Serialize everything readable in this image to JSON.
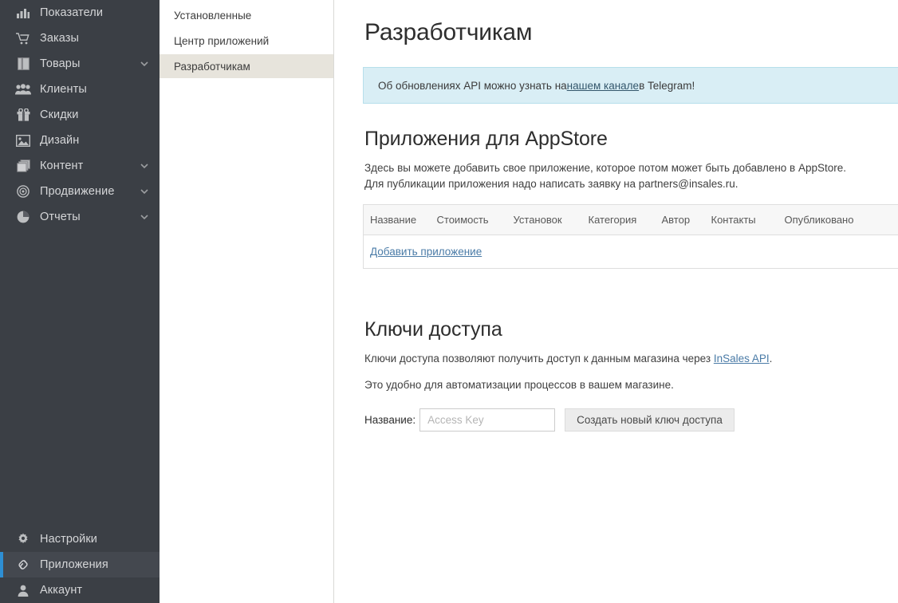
{
  "sidebar": {
    "items": [
      {
        "label": "Показатели",
        "icon": "bar-chart-icon",
        "chevron": false,
        "active": false
      },
      {
        "label": "Заказы",
        "icon": "cart-icon",
        "chevron": false,
        "active": false
      },
      {
        "label": "Товары",
        "icon": "box-icon",
        "chevron": true,
        "active": false
      },
      {
        "label": "Клиенты",
        "icon": "users-icon",
        "chevron": false,
        "active": false
      },
      {
        "label": "Скидки",
        "icon": "gift-icon",
        "chevron": false,
        "active": false
      },
      {
        "label": "Дизайн",
        "icon": "image-icon",
        "chevron": false,
        "active": false
      },
      {
        "label": "Контент",
        "icon": "layers-icon",
        "chevron": true,
        "active": false
      },
      {
        "label": "Продвижение",
        "icon": "target-icon",
        "chevron": true,
        "active": false
      },
      {
        "label": "Отчеты",
        "icon": "pie-chart-icon",
        "chevron": true,
        "active": false
      }
    ],
    "bottom_items": [
      {
        "label": "Настройки",
        "icon": "gear-icon",
        "active": false
      },
      {
        "label": "Приложения",
        "icon": "link-icon",
        "active": true
      },
      {
        "label": "Аккаунт",
        "icon": "user-icon",
        "active": false
      }
    ],
    "accent_color": "#2e8fd4",
    "background_color": "#3b3f45"
  },
  "subnav": {
    "items": [
      {
        "label": "Установленные",
        "active": false
      },
      {
        "label": "Центр приложений",
        "active": false
      },
      {
        "label": "Разработчикам",
        "active": true
      }
    ],
    "active_background": "#e7e4dc"
  },
  "main": {
    "page_title": "Разработчикам",
    "banner": {
      "prefix": "Об обновлениях API можно узнать на ",
      "link": "нашем канале",
      "suffix": " в Telegram!",
      "background_color": "#d9eef5",
      "border_color": "#b6dfeb"
    },
    "appstore": {
      "title": "Приложения для AppStore",
      "paragraph_1": "Здесь вы можете добавить свое приложение, которое потом может быть добавлено в AppStore.",
      "paragraph_2": "Для публикации приложения надо написать заявку на partners@insales.ru.",
      "table": {
        "columns": [
          "Название",
          "Стоимость",
          "Установок",
          "Категория",
          "Автор",
          "Контакты",
          "Опубликовано"
        ],
        "rows": [],
        "add_link": "Добавить приложение"
      }
    },
    "keys": {
      "title": "Ключи доступа",
      "paragraph_1_prefix": "Ключи доступа позволяют получить доступ к данным магазина через ",
      "paragraph_1_link": "InSales API",
      "paragraph_1_suffix": ".",
      "paragraph_2": "Это удобно для автоматизации процессов в вашем магазине.",
      "form": {
        "label": "Название:",
        "input_value": "",
        "input_placeholder": "Access Key",
        "button_label": "Создать новый ключ доступа"
      }
    }
  }
}
